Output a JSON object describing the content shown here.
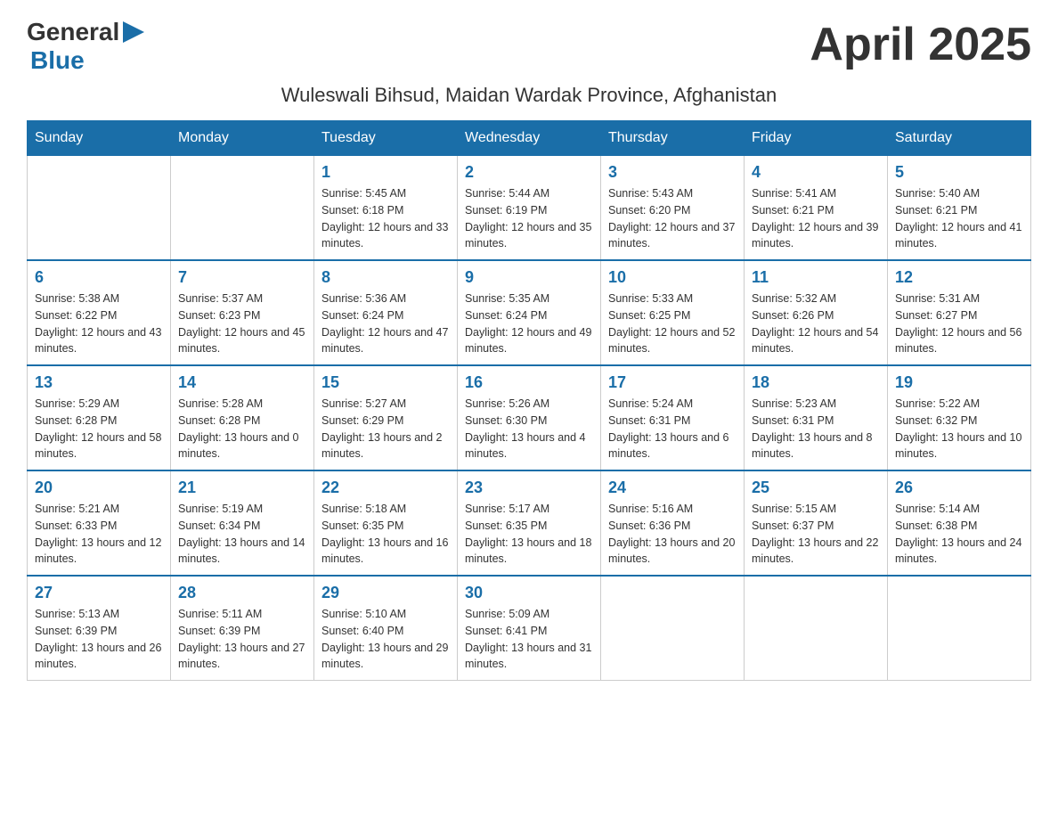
{
  "header": {
    "logo_general": "General",
    "logo_blue": "Blue",
    "month_title": "April 2025",
    "subtitle": "Wuleswali Bihsud, Maidan Wardak Province, Afghanistan"
  },
  "weekdays": [
    "Sunday",
    "Monday",
    "Tuesday",
    "Wednesday",
    "Thursday",
    "Friday",
    "Saturday"
  ],
  "weeks": [
    [
      {
        "day": "",
        "sunrise": "",
        "sunset": "",
        "daylight": ""
      },
      {
        "day": "",
        "sunrise": "",
        "sunset": "",
        "daylight": ""
      },
      {
        "day": "1",
        "sunrise": "Sunrise: 5:45 AM",
        "sunset": "Sunset: 6:18 PM",
        "daylight": "Daylight: 12 hours and 33 minutes."
      },
      {
        "day": "2",
        "sunrise": "Sunrise: 5:44 AM",
        "sunset": "Sunset: 6:19 PM",
        "daylight": "Daylight: 12 hours and 35 minutes."
      },
      {
        "day": "3",
        "sunrise": "Sunrise: 5:43 AM",
        "sunset": "Sunset: 6:20 PM",
        "daylight": "Daylight: 12 hours and 37 minutes."
      },
      {
        "day": "4",
        "sunrise": "Sunrise: 5:41 AM",
        "sunset": "Sunset: 6:21 PM",
        "daylight": "Daylight: 12 hours and 39 minutes."
      },
      {
        "day": "5",
        "sunrise": "Sunrise: 5:40 AM",
        "sunset": "Sunset: 6:21 PM",
        "daylight": "Daylight: 12 hours and 41 minutes."
      }
    ],
    [
      {
        "day": "6",
        "sunrise": "Sunrise: 5:38 AM",
        "sunset": "Sunset: 6:22 PM",
        "daylight": "Daylight: 12 hours and 43 minutes."
      },
      {
        "day": "7",
        "sunrise": "Sunrise: 5:37 AM",
        "sunset": "Sunset: 6:23 PM",
        "daylight": "Daylight: 12 hours and 45 minutes."
      },
      {
        "day": "8",
        "sunrise": "Sunrise: 5:36 AM",
        "sunset": "Sunset: 6:24 PM",
        "daylight": "Daylight: 12 hours and 47 minutes."
      },
      {
        "day": "9",
        "sunrise": "Sunrise: 5:35 AM",
        "sunset": "Sunset: 6:24 PM",
        "daylight": "Daylight: 12 hours and 49 minutes."
      },
      {
        "day": "10",
        "sunrise": "Sunrise: 5:33 AM",
        "sunset": "Sunset: 6:25 PM",
        "daylight": "Daylight: 12 hours and 52 minutes."
      },
      {
        "day": "11",
        "sunrise": "Sunrise: 5:32 AM",
        "sunset": "Sunset: 6:26 PM",
        "daylight": "Daylight: 12 hours and 54 minutes."
      },
      {
        "day": "12",
        "sunrise": "Sunrise: 5:31 AM",
        "sunset": "Sunset: 6:27 PM",
        "daylight": "Daylight: 12 hours and 56 minutes."
      }
    ],
    [
      {
        "day": "13",
        "sunrise": "Sunrise: 5:29 AM",
        "sunset": "Sunset: 6:28 PM",
        "daylight": "Daylight: 12 hours and 58 minutes."
      },
      {
        "day": "14",
        "sunrise": "Sunrise: 5:28 AM",
        "sunset": "Sunset: 6:28 PM",
        "daylight": "Daylight: 13 hours and 0 minutes."
      },
      {
        "day": "15",
        "sunrise": "Sunrise: 5:27 AM",
        "sunset": "Sunset: 6:29 PM",
        "daylight": "Daylight: 13 hours and 2 minutes."
      },
      {
        "day": "16",
        "sunrise": "Sunrise: 5:26 AM",
        "sunset": "Sunset: 6:30 PM",
        "daylight": "Daylight: 13 hours and 4 minutes."
      },
      {
        "day": "17",
        "sunrise": "Sunrise: 5:24 AM",
        "sunset": "Sunset: 6:31 PM",
        "daylight": "Daylight: 13 hours and 6 minutes."
      },
      {
        "day": "18",
        "sunrise": "Sunrise: 5:23 AM",
        "sunset": "Sunset: 6:31 PM",
        "daylight": "Daylight: 13 hours and 8 minutes."
      },
      {
        "day": "19",
        "sunrise": "Sunrise: 5:22 AM",
        "sunset": "Sunset: 6:32 PM",
        "daylight": "Daylight: 13 hours and 10 minutes."
      }
    ],
    [
      {
        "day": "20",
        "sunrise": "Sunrise: 5:21 AM",
        "sunset": "Sunset: 6:33 PM",
        "daylight": "Daylight: 13 hours and 12 minutes."
      },
      {
        "day": "21",
        "sunrise": "Sunrise: 5:19 AM",
        "sunset": "Sunset: 6:34 PM",
        "daylight": "Daylight: 13 hours and 14 minutes."
      },
      {
        "day": "22",
        "sunrise": "Sunrise: 5:18 AM",
        "sunset": "Sunset: 6:35 PM",
        "daylight": "Daylight: 13 hours and 16 minutes."
      },
      {
        "day": "23",
        "sunrise": "Sunrise: 5:17 AM",
        "sunset": "Sunset: 6:35 PM",
        "daylight": "Daylight: 13 hours and 18 minutes."
      },
      {
        "day": "24",
        "sunrise": "Sunrise: 5:16 AM",
        "sunset": "Sunset: 6:36 PM",
        "daylight": "Daylight: 13 hours and 20 minutes."
      },
      {
        "day": "25",
        "sunrise": "Sunrise: 5:15 AM",
        "sunset": "Sunset: 6:37 PM",
        "daylight": "Daylight: 13 hours and 22 minutes."
      },
      {
        "day": "26",
        "sunrise": "Sunrise: 5:14 AM",
        "sunset": "Sunset: 6:38 PM",
        "daylight": "Daylight: 13 hours and 24 minutes."
      }
    ],
    [
      {
        "day": "27",
        "sunrise": "Sunrise: 5:13 AM",
        "sunset": "Sunset: 6:39 PM",
        "daylight": "Daylight: 13 hours and 26 minutes."
      },
      {
        "day": "28",
        "sunrise": "Sunrise: 5:11 AM",
        "sunset": "Sunset: 6:39 PM",
        "daylight": "Daylight: 13 hours and 27 minutes."
      },
      {
        "day": "29",
        "sunrise": "Sunrise: 5:10 AM",
        "sunset": "Sunset: 6:40 PM",
        "daylight": "Daylight: 13 hours and 29 minutes."
      },
      {
        "day": "30",
        "sunrise": "Sunrise: 5:09 AM",
        "sunset": "Sunset: 6:41 PM",
        "daylight": "Daylight: 13 hours and 31 minutes."
      },
      {
        "day": "",
        "sunrise": "",
        "sunset": "",
        "daylight": ""
      },
      {
        "day": "",
        "sunrise": "",
        "sunset": "",
        "daylight": ""
      },
      {
        "day": "",
        "sunrise": "",
        "sunset": "",
        "daylight": ""
      }
    ]
  ]
}
